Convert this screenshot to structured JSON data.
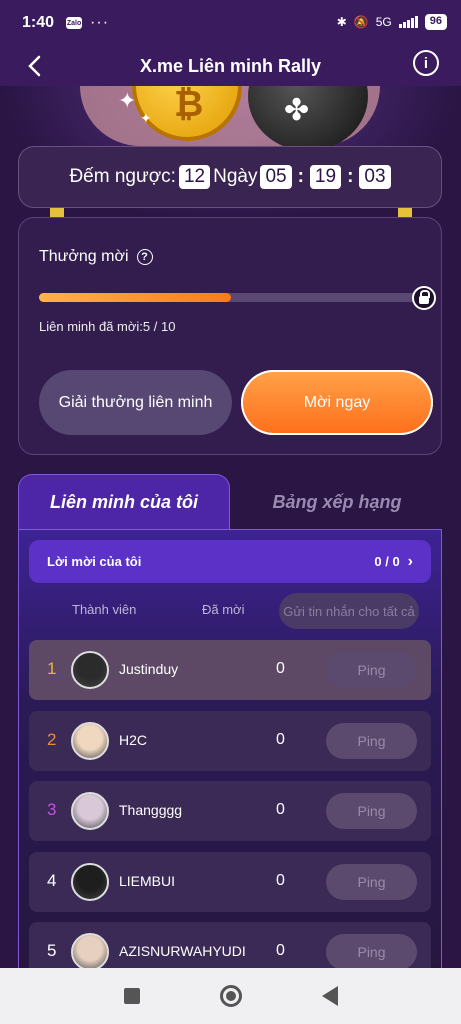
{
  "status_bar": {
    "time": "1:40",
    "app_badge": "Zalo",
    "more": "···",
    "network": "5G",
    "battery": "96"
  },
  "header": {
    "title": "X.me Liên minh Rally"
  },
  "countdown": {
    "label": "Đếm ngược:",
    "days": "12",
    "days_label": "Ngày",
    "hours": "05",
    "minutes": "19",
    "seconds": "03"
  },
  "reward": {
    "title": "Thưởng mời",
    "progress": 0.5,
    "invited_text": "Liên minh đã mời:5 / 10",
    "alliance_button": "Giải thưởng liên minh",
    "invite_button": "Mời ngay"
  },
  "tabs": {
    "my_alliance": "Liên minh của tôi",
    "leaderboard": "Bảng xếp hạng"
  },
  "my_invites": {
    "label": "Lời mời của tôi",
    "value": "0 / 0"
  },
  "columns": {
    "member": "Thành viên",
    "invited": "Đã mời",
    "message_all": "Gửi tin nhắn cho tất cả"
  },
  "ping_label": "Ping",
  "members": [
    {
      "rank": "1",
      "name": "Justinduy",
      "invited": "0",
      "rank_color": "#e6b43c"
    },
    {
      "rank": "2",
      "name": "H2C",
      "invited": "0",
      "rank_color": "#e98a3c"
    },
    {
      "rank": "3",
      "name": "Thangggg",
      "invited": "0",
      "rank_color": "#c050e0"
    },
    {
      "rank": "4",
      "name": "LIEMBUI",
      "invited": "0",
      "rank_color": "#ffffff"
    },
    {
      "rank": "5",
      "name": "AZISNURWAHYUDI",
      "invited": "0",
      "rank_color": "#ffffff"
    }
  ],
  "colors": {
    "accent_orange": "#ff7a1a",
    "tab_purple": "#4c26a6",
    "background": "#2a1545"
  }
}
